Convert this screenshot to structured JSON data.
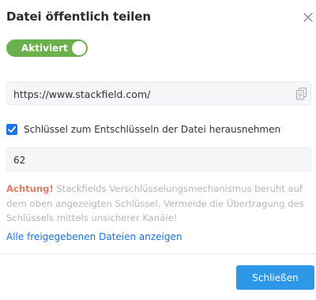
{
  "dialog": {
    "title": "Datei öffentlich teilen",
    "close_icon": "close-icon"
  },
  "toggle": {
    "label": "Aktiviert",
    "state": "on",
    "color": "#6ab04c"
  },
  "share_url": {
    "value": "https://www.stackfield.com/",
    "copy_icon": "copy-icon"
  },
  "key_option": {
    "checked": true,
    "label": "Schlüssel zum Entschlüsseln der Datei herausnehmen"
  },
  "key_field": {
    "value": "62"
  },
  "warning": {
    "strong": "Achtung!",
    "text": " Stackfields Verschlüsselungsmechanismus beruht auf dem oben angezeigten Schlüssel. Vermeide die Übertragung des Schlüssels mittels unsicherer Kanäle!",
    "accent_color": "#e07b67"
  },
  "links": {
    "all_shared": "Alle freigegebenen Dateien anzeigen"
  },
  "footer": {
    "close_button": "Schließen",
    "button_color": "#2d97e8"
  }
}
